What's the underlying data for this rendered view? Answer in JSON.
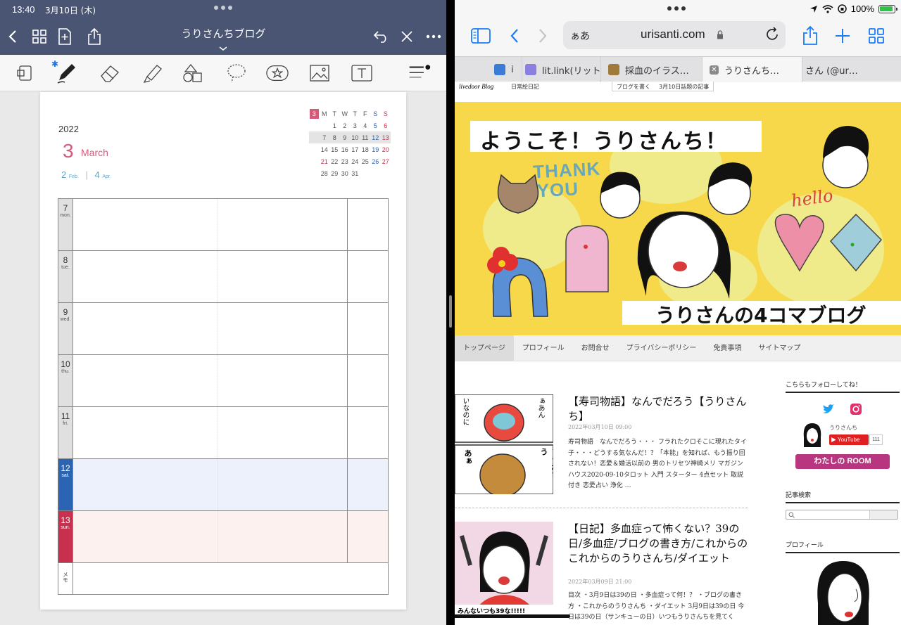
{
  "left": {
    "status": {
      "time": "13:40",
      "date": "3月10日 (木)"
    },
    "nav": {
      "title": "うりさんちブログ"
    },
    "planner": {
      "year": "2022",
      "month_num": "3",
      "month_name": "March",
      "prev_num": "2",
      "prev_abbr": "Feb.",
      "next_num": "4",
      "next_abbr": "Apr.",
      "mini_header": [
        "3",
        "M",
        "T",
        "W",
        "T",
        "F",
        "S",
        "S"
      ],
      "mini_rows": [
        [
          "",
          "",
          "1",
          "2",
          "3",
          "4",
          "5",
          "6"
        ],
        [
          "",
          "7",
          "8",
          "9",
          "10",
          "11",
          "12",
          "13"
        ],
        [
          "",
          "14",
          "15",
          "16",
          "17",
          "18",
          "19",
          "20"
        ],
        [
          "",
          "21",
          "22",
          "23",
          "24",
          "25",
          "26",
          "27"
        ],
        [
          "",
          "28",
          "29",
          "30",
          "31",
          "",
          "",
          ""
        ]
      ],
      "days": [
        {
          "num": "7",
          "wd": "mon."
        },
        {
          "num": "8",
          "wd": "tue."
        },
        {
          "num": "9",
          "wd": "wed."
        },
        {
          "num": "10",
          "wd": "thu."
        },
        {
          "num": "11",
          "wd": "fri."
        },
        {
          "num": "12",
          "wd": "sat."
        },
        {
          "num": "13",
          "wd": "sun."
        }
      ],
      "memo_label": "メモ"
    }
  },
  "right": {
    "status": {
      "battery": "100%"
    },
    "url": {
      "aa": "ぁあ",
      "host": "urisanti.com"
    },
    "tabs": [
      {
        "label": "i",
        "color": "#3a7bd5"
      },
      {
        "label": "lit.link(リット",
        "color": "#8b7fe0"
      },
      {
        "label": "採血のイラス…",
        "color": "#a07a3a"
      },
      {
        "label": "うりさんち…",
        "color": "#8a8a8a"
      },
      {
        "label": "さん (@ur…",
        "color": ""
      }
    ],
    "livedoor": {
      "logo": "livedoor Blog",
      "sub": "日常絵日記",
      "write": "ブログを書く",
      "topic": "3月10日話題の記事"
    },
    "banner": {
      "welcome": "ようこそ！うりさんち！",
      "thank": "THANK",
      "you": "YOU",
      "hello": "hello",
      "bottom": "うりさんの4コマブログ"
    },
    "gnav": [
      "トップページ",
      "プロフィール",
      "お問合せ",
      "プライバシーポリシー",
      "免責事項",
      "サイトマップ"
    ],
    "posts": [
      {
        "title": "【寿司物語】なんでだろう【うりさんち】",
        "date": "2022年03月10日 09:00",
        "excerpt": "寿司物語　なんでだろう・・・ フラれたクロそこに現れたタイ子・・・どうする気なんだ！？「本能」を知れば、もう振り回されない！恋愛＆婚活以前の 男のトリセツ神崎メリ マガジンハウス2020-09-10タロット 入門 スターター 4点セット 取説付き 恋愛占い 浄化 …"
      },
      {
        "title": "【日記】多血症って怖くない？39の日/多血症/ブログの書き方/これからのこれからのうりさんち/ダイエット",
        "date": "2022年03月09日 21:00",
        "excerpt": "目次 ・3月9日は39の日 ・多血症って何！？ ・ブログの書き方 ・これからのうりさんち ・ダイエット 3月9日は39の日 今日は39の日（サンキューの日）いつもうりさんちを見てく"
      }
    ],
    "comic": {
      "bubble1": "ぁあん",
      "bubble2": "いなのに",
      "bubble3": "フラれちゃう",
      "bubble4": "あぁ",
      "caption": "みんないつも39な!!!!!"
    },
    "sidebar": {
      "follow": "こちらもフォローしてね！",
      "name": "うりさんち",
      "youtube": "YouTube",
      "yt_count": "111",
      "room": "わたしの ROOM",
      "search_heading": "記事検索",
      "profile_heading": "プロフィール"
    }
  }
}
